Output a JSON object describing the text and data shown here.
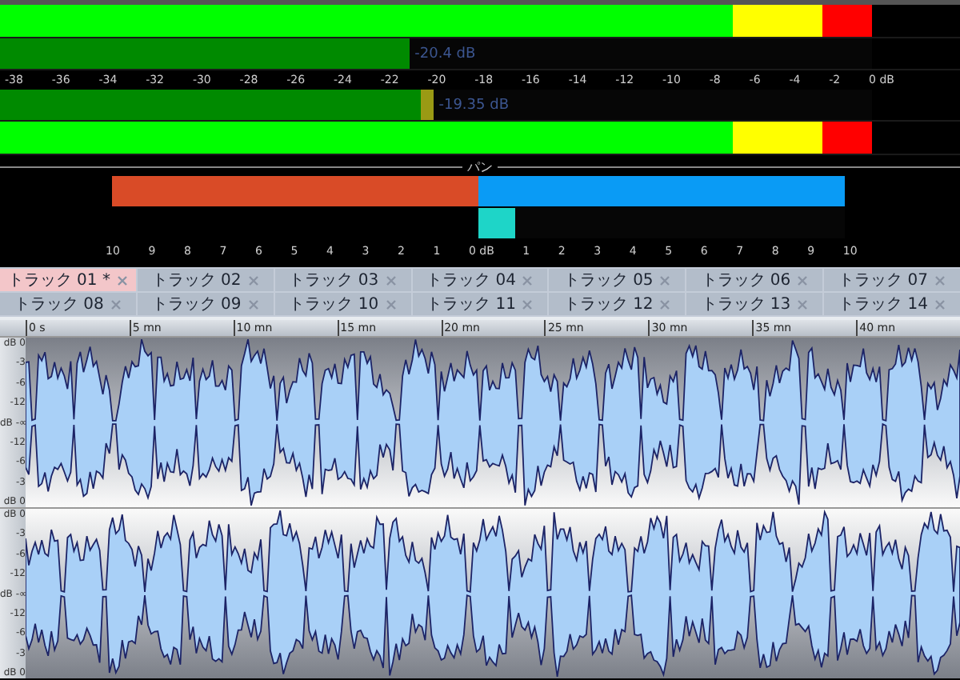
{
  "meters": [
    {
      "kind": "peak",
      "level": 1
    },
    {
      "kind": "average",
      "level": 0.47,
      "reading": "-20.4 dB",
      "hold": false
    },
    {
      "kind": "scale"
    },
    {
      "kind": "average",
      "level": 0.483,
      "reading": "-19.35 dB",
      "hold": true
    },
    {
      "kind": "peak",
      "level": 1
    }
  ],
  "meter_scale": [
    "-38",
    "-36",
    "-34",
    "-32",
    "-30",
    "-28",
    "-26",
    "-24",
    "-22",
    "-20",
    "-18",
    "-16",
    "-14",
    "-12",
    "-10",
    "-8",
    "-6",
    "-4",
    "-2",
    "0 dB"
  ],
  "pan": {
    "label": "パン",
    "bars": [
      {
        "kind": "left",
        "level": 1
      },
      {
        "kind": "right",
        "level": 1
      },
      {
        "kind": "center",
        "level": 0.1
      }
    ],
    "scale": [
      "10",
      "9",
      "8",
      "7",
      "6",
      "5",
      "4",
      "3",
      "2",
      "1",
      "0 dB",
      "1",
      "2",
      "3",
      "4",
      "5",
      "6",
      "7",
      "8",
      "9",
      "10"
    ]
  },
  "tabs": [
    {
      "label": "トラック 01 *",
      "selected": true
    },
    {
      "label": "トラック 02",
      "selected": false
    },
    {
      "label": "トラック 03",
      "selected": false
    },
    {
      "label": "トラック 04",
      "selected": false
    },
    {
      "label": "トラック 05",
      "selected": false
    },
    {
      "label": "トラック 06",
      "selected": false
    },
    {
      "label": "トラック 07",
      "selected": false
    },
    {
      "label": "トラック 08",
      "selected": false
    },
    {
      "label": "トラック 09",
      "selected": false
    },
    {
      "label": "トラック 10",
      "selected": false
    },
    {
      "label": "トラック 11",
      "selected": false
    },
    {
      "label": "トラック 12",
      "selected": false
    },
    {
      "label": "トラック 13",
      "selected": false
    },
    {
      "label": "トラック 14",
      "selected": false
    }
  ],
  "timeline": [
    "0 s",
    "5 mn",
    "10 mn",
    "15 mn",
    "20 mn",
    "25 mn",
    "30 mn",
    "35 mn",
    "40 mn"
  ],
  "channels": [
    {
      "kind": "top",
      "axis": [
        "dB 0",
        "-3",
        "-6",
        "-12",
        "dB -∞",
        "-12",
        "-6",
        "-3",
        "dB 0"
      ]
    },
    {
      "kind": "bottom",
      "axis": [
        "dB 0",
        "-3",
        "-6",
        "-12",
        "dB -∞",
        "-12",
        "-6",
        "-3",
        "dB 0"
      ]
    }
  ]
}
